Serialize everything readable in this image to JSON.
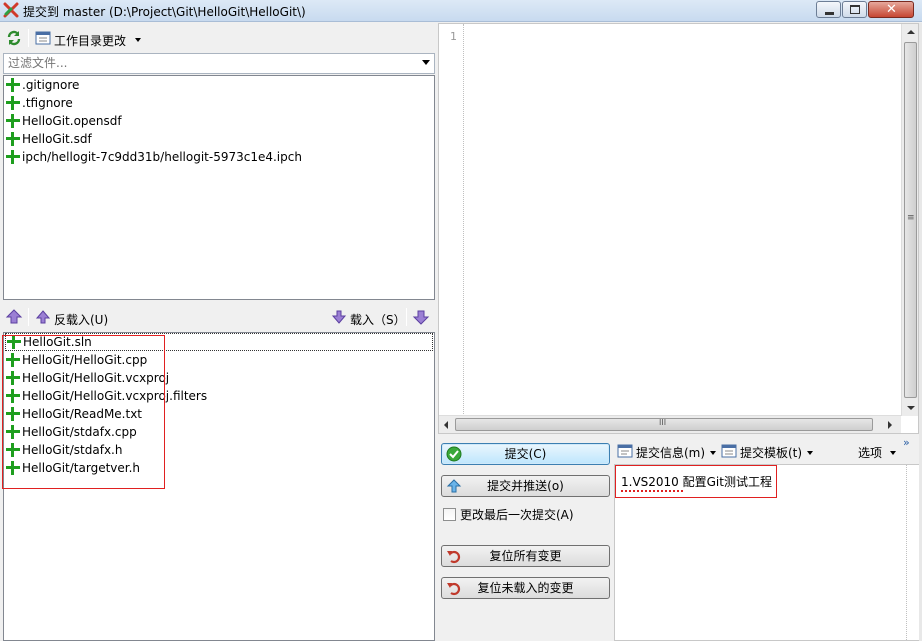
{
  "window": {
    "title": "提交到 master (D:\\Project\\Git\\HelloGit\\HelloGit\\)",
    "buttons": [
      "minimize-icon",
      "maximize-icon",
      "close-icon"
    ],
    "close_glyph": "✕"
  },
  "left_panel": {
    "top_toolbar": {
      "refresh_icon": "refresh-icon",
      "dropdown_label": "工作目录更改"
    },
    "filter": {
      "placeholder": "过滤文件..."
    },
    "unstaged_files": [
      ".gitignore",
      ".tfignore",
      "HelloGit.opensdf",
      "HelloGit.sdf",
      "ipch/hellogit-7c9dd31b/hellogit-5973c1e4.ipch"
    ],
    "stage_toolbar": {
      "unstage_label": "反载入(U)",
      "stage_label": "载入（S）"
    },
    "staged_files": [
      "HelloGit.sln",
      "HelloGit/HelloGit.cpp",
      "HelloGit/HelloGit.vcxproj",
      "HelloGit/HelloGit.vcxproj.filters",
      "HelloGit/ReadMe.txt",
      "HelloGit/stdafx.cpp",
      "HelloGit/stdafx.h",
      "HelloGit/targetver.h"
    ]
  },
  "diff_editor": {
    "line_numbers": [
      "1"
    ]
  },
  "actions": {
    "commit": "提交(C)",
    "commit_push": "提交并推送(o)",
    "amend_label": "更改最后一次提交(A)",
    "amend_checked": false,
    "reset_all": "复位所有变更",
    "reset_unstaged": "复位未载入的变更"
  },
  "message_toolbar": {
    "commit_message": "提交信息(m)",
    "commit_template": "提交模板(t)",
    "options": "选项",
    "overflow": "»"
  },
  "commit_message_text": "1.VS2010 配置Git测试工程",
  "colors": {
    "accent_red": "#e02020",
    "add_green": "#1e9e1e",
    "button_blue": "#bee6fd"
  }
}
